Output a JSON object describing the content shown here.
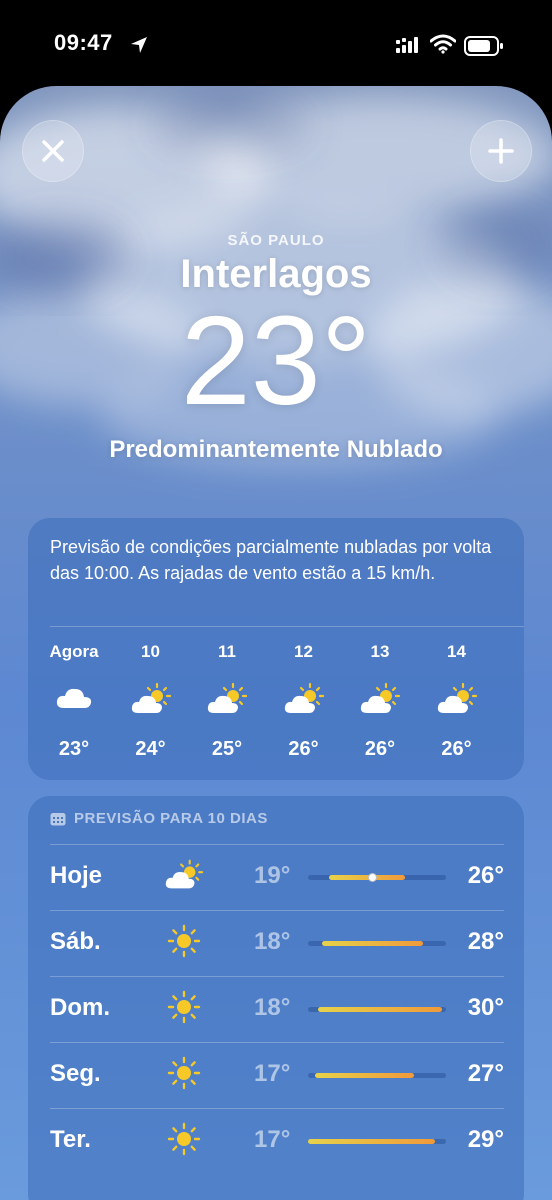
{
  "status_bar": {
    "time": "09:47"
  },
  "header": {
    "region": "SÃO PAULO",
    "city": "Interlagos",
    "temperature": "23°",
    "condition": "Predominantemente Nublado"
  },
  "hourly": {
    "summary": "Previsão de condições parcialmente nubladas por volta das 10:00. As rajadas de vento estão a 15 km/h.",
    "hours": [
      {
        "label": "Agora",
        "icon": "cloud-icon",
        "temp": "23°"
      },
      {
        "label": "10",
        "icon": "partly-sunny-icon",
        "temp": "24°"
      },
      {
        "label": "11",
        "icon": "partly-sunny-icon",
        "temp": "25°"
      },
      {
        "label": "12",
        "icon": "partly-sunny-icon",
        "temp": "26°"
      },
      {
        "label": "13",
        "icon": "partly-sunny-icon",
        "temp": "26°"
      },
      {
        "label": "14",
        "icon": "partly-sunny-icon",
        "temp": "26°"
      }
    ]
  },
  "daily": {
    "title": "PREVISÃO PARA 10 DIAS",
    "days": [
      {
        "name": "Hoje",
        "icon": "partly-sunny-icon",
        "low": "19°",
        "high": "26°",
        "range_start": 0.15,
        "range_end": 0.7,
        "current": 0.47
      },
      {
        "name": "Sáb.",
        "icon": "sun-icon",
        "low": "18°",
        "high": "28°",
        "range_start": 0.1,
        "range_end": 0.83
      },
      {
        "name": "Dom.",
        "icon": "sun-icon",
        "low": "18°",
        "high": "30°",
        "range_start": 0.07,
        "range_end": 0.97
      },
      {
        "name": "Seg.",
        "icon": "sun-icon",
        "low": "17°",
        "high": "27°",
        "range_start": 0.05,
        "range_end": 0.77
      },
      {
        "name": "Ter.",
        "icon": "sun-icon",
        "low": "17°",
        "high": "29°",
        "range_start": 0.0,
        "range_end": 0.92
      }
    ]
  }
}
